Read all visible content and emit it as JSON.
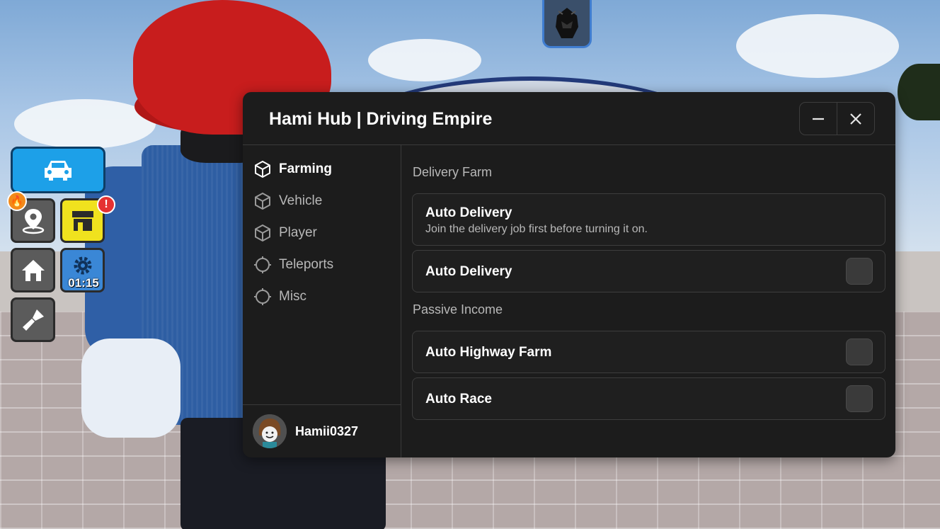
{
  "hub": {
    "title": "Hami Hub | Driving Empire",
    "controls": {
      "minimize_icon": "minus-icon",
      "close_icon": "close-icon"
    },
    "nav": [
      {
        "label": "Farming",
        "icon": "cube-icon",
        "active": true
      },
      {
        "label": "Vehicle",
        "icon": "cube-icon",
        "active": false
      },
      {
        "label": "Player",
        "icon": "cube-icon",
        "active": false
      },
      {
        "label": "Teleports",
        "icon": "crosshair-icon",
        "active": false
      },
      {
        "label": "Misc",
        "icon": "crosshair-icon",
        "active": false
      }
    ],
    "user": {
      "name": "Hamii0327"
    },
    "sections": [
      {
        "label": "Delivery Farm",
        "options": [
          {
            "title": "Auto Delivery",
            "description": "Join the delivery job first before turning it on."
          },
          {
            "title": "Auto Delivery",
            "toggle": false
          }
        ]
      },
      {
        "label": "Passive Income",
        "options": [
          {
            "title": "Auto Highway Farm",
            "toggle": false
          },
          {
            "title": "Auto Race",
            "toggle": false
          }
        ]
      }
    ]
  },
  "hud": {
    "timer": "01:15",
    "alert_badge": "!",
    "buttons": [
      "car-icon",
      "map-pin-icon",
      "shop-icon",
      "home-icon",
      "gear-icon",
      "paint-icon"
    ]
  },
  "colors": {
    "window_bg": "#1c1c1c",
    "border": "#3a3a3a",
    "text_primary": "#ffffff",
    "text_secondary": "#b8b8b8",
    "hud_car": "#1da0e8",
    "hud_shop": "#f0e21e",
    "alert": "#e53131"
  }
}
